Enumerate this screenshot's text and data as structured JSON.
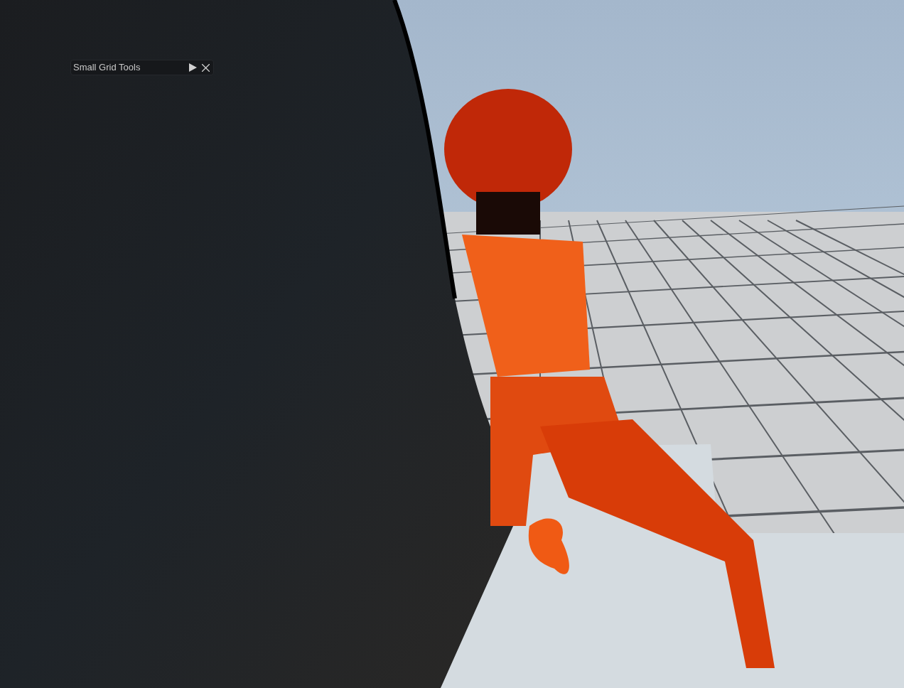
{
  "panel": {
    "title": "Small Grid Tools"
  }
}
